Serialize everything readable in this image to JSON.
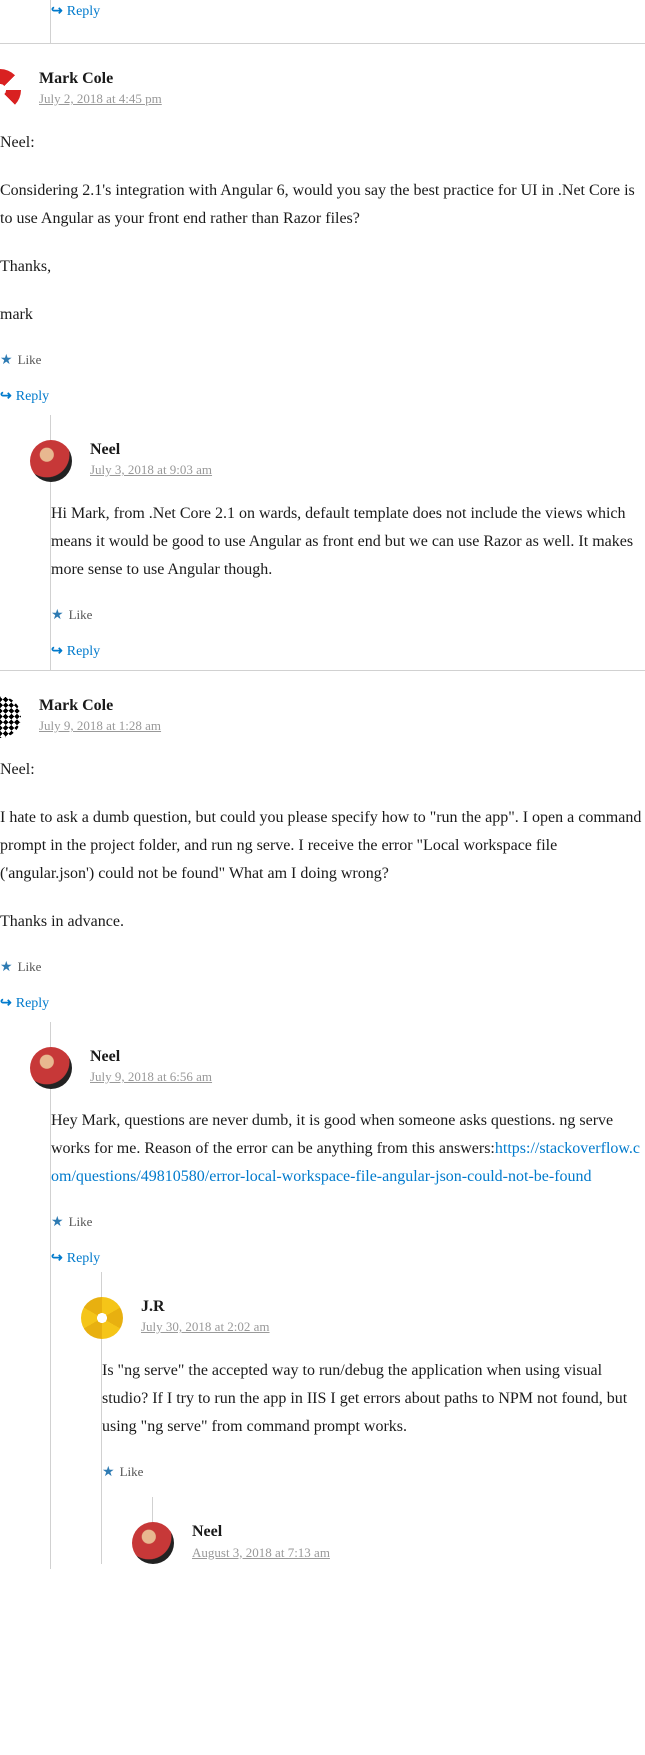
{
  "ui": {
    "like": "Like",
    "reply": "Reply"
  },
  "comments": [
    {
      "author": "",
      "date": "",
      "avatar": "",
      "body": [],
      "show_like": false,
      "show_header": false,
      "depth": 1
    },
    {
      "author": "Mark Cole",
      "date": "July 2, 2018 at 4:45 pm",
      "avatar": "av-red",
      "body": [
        "Neel:",
        "Considering 2.1's integration with Angular 6, would you say the best practice for UI in .Net Core is to use Angular as your front end rather than Razor files?",
        "Thanks,",
        "mark"
      ],
      "show_like": true,
      "show_header": true,
      "depth": 0
    },
    {
      "author": "Neel",
      "date": "July 3, 2018 at 9:03 am",
      "avatar": "av-neel",
      "body": [
        "Hi Mark, from .Net Core 2.1 on wards, default template does not include the views which means it would be good to use Angular as front end but we can use Razor as well. It makes more sense to use Angular though."
      ],
      "show_like": true,
      "show_header": true,
      "depth": 1
    },
    {
      "author": "Mark Cole",
      "date": "July 9, 2018 at 1:28 am",
      "avatar": "av-bw",
      "body": [
        "Neel:",
        "I hate to ask a dumb question, but could you please specify how to \"run the app\". I open a command prompt in the project folder, and run ng serve. I receive the error \"Local workspace file ('angular.json') could not be found\" What am I doing wrong?",
        "Thanks in advance."
      ],
      "show_like": true,
      "show_header": true,
      "depth": 0
    },
    {
      "author": "Neel",
      "date": "July 9, 2018 at 6:56 am",
      "avatar": "av-neel",
      "body_prefix": "Hey Mark, questions are never dumb, it is good when someone asks questions. ng serve works for me. Reason of the error can be anything from this answers:",
      "link": "https://stackoverflow.com/questions/49810580/error-local-workspace-file-angular-json-could-not-be-found",
      "show_like": true,
      "show_header": true,
      "depth": 1
    },
    {
      "author": "J.R",
      "date": "July 30, 2018 at 2:02 am",
      "avatar": "av-yellow",
      "body": [
        "Is \"ng serve\" the accepted way to run/debug the application when using visual studio? If I try to run the app in IIS I get errors about paths to NPM not found, but using \"ng serve\" from command prompt works."
      ],
      "show_like": true,
      "show_reply": false,
      "show_header": true,
      "depth": 2
    },
    {
      "author": "Neel",
      "date": "August 3, 2018 at 7:13 am",
      "avatar": "av-neel",
      "body": [],
      "show_like": false,
      "show_reply": false,
      "show_header": true,
      "depth": 3
    }
  ]
}
